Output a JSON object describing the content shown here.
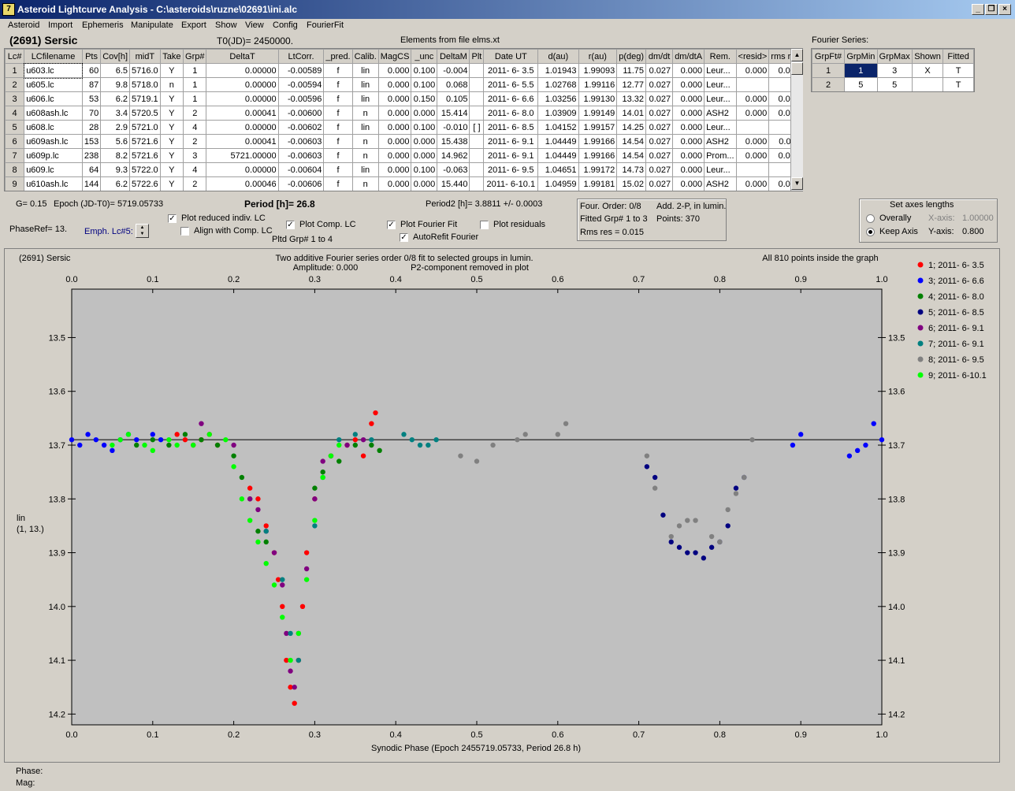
{
  "window": {
    "title": "Asteroid Lightcurve Analysis - C:\\asteroids\\ruzne\\02691\\ini.alc",
    "icon": "app-logo-icon"
  },
  "menu": [
    "Asteroid",
    "Import",
    "Ephemeris",
    "Manipulate",
    "Export",
    "Show",
    "View",
    "Config",
    "FourierFit"
  ],
  "header": {
    "asteroid": "(2691) Sersic",
    "t0": "T0(JD)= 2450000.",
    "elements": "Elements from file elms.xt",
    "fourier_title": "Fourier Series:"
  },
  "table": {
    "columns": [
      "Lc#",
      "LCfilename",
      "Pts",
      "Cov[h]",
      "midT",
      "Take",
      "Grp#",
      "DeltaT",
      "LtCorr.",
      "_pred.",
      "Calib.",
      "MagCS",
      "_unc",
      "DeltaM",
      "Plt",
      "Date UT",
      "d(au)",
      "r(au)",
      "p(deg)",
      "dm/dt",
      "dm/dtA",
      "Rem.",
      "<resid>",
      "rms res"
    ],
    "rows": [
      [
        "1",
        "u603.lc",
        "60",
        "6.5",
        "5716.0",
        "Y",
        "1",
        "0.00000",
        "-0.00589",
        "f",
        "lin",
        "0.000",
        "0.100",
        "-0.004",
        "",
        "2011- 6- 3.5",
        "1.01943",
        "1.99093",
        "11.75",
        "0.027",
        "0.000",
        "Leur...",
        "0.000",
        "0.017"
      ],
      [
        "2",
        "u605.lc",
        "87",
        "9.8",
        "5718.0",
        "n",
        "1",
        "0.00000",
        "-0.00594",
        "f",
        "lin",
        "0.000",
        "0.100",
        "0.068",
        "",
        "2011- 6- 5.5",
        "1.02768",
        "1.99116",
        "12.77",
        "0.027",
        "0.000",
        "Leur...",
        "",
        ""
      ],
      [
        "3",
        "u606.lc",
        "53",
        "6.2",
        "5719.1",
        "Y",
        "1",
        "0.00000",
        "-0.00596",
        "f",
        "lin",
        "0.000",
        "0.150",
        "0.105",
        "",
        "2011- 6- 6.6",
        "1.03256",
        "1.99130",
        "13.32",
        "0.027",
        "0.000",
        "Leur...",
        "0.000",
        "0.016"
      ],
      [
        "4",
        "u608ash.lc",
        "70",
        "3.4",
        "5720.5",
        "Y",
        "2",
        "0.00041",
        "-0.00600",
        "f",
        "n",
        "0.000",
        "0.000",
        "15.414",
        "",
        "2011- 6- 8.0",
        "1.03909",
        "1.99149",
        "14.01",
        "0.027",
        "0.000",
        "ASH2",
        "0.000",
        "0.018"
      ],
      [
        "5",
        "u608.lc",
        "28",
        "2.9",
        "5721.0",
        "Y",
        "4",
        "0.00000",
        "-0.00602",
        "f",
        "lin",
        "0.000",
        "0.100",
        "-0.010",
        "[ ]",
        "2011- 6- 8.5",
        "1.04152",
        "1.99157",
        "14.25",
        "0.027",
        "0.000",
        "Leur...",
        "",
        ""
      ],
      [
        "6",
        "u609ash.lc",
        "153",
        "5.6",
        "5721.6",
        "Y",
        "2",
        "0.00041",
        "-0.00603",
        "f",
        "n",
        "0.000",
        "0.000",
        "15.438",
        "",
        "2011- 6- 9.1",
        "1.04449",
        "1.99166",
        "14.54",
        "0.027",
        "0.000",
        "ASH2",
        "0.000",
        "0.011"
      ],
      [
        "7",
        "u609p.lc",
        "238",
        "8.2",
        "5721.6",
        "Y",
        "3",
        "5721.00000",
        "-0.00603",
        "f",
        "n",
        "0.000",
        "0.000",
        "14.962",
        "",
        "2011- 6- 9.1",
        "1.04449",
        "1.99166",
        "14.54",
        "0.027",
        "0.000",
        "Prom...",
        "0.000",
        "0.014"
      ],
      [
        "8",
        "u609.lc",
        "64",
        "9.3",
        "5722.0",
        "Y",
        "4",
        "0.00000",
        "-0.00604",
        "f",
        "lin",
        "0.000",
        "0.100",
        "-0.063",
        "",
        "2011- 6- 9.5",
        "1.04651",
        "1.99172",
        "14.73",
        "0.027",
        "0.000",
        "Leur...",
        "",
        ""
      ],
      [
        "9",
        "u610ash.lc",
        "144",
        "6.2",
        "5722.6",
        "Y",
        "2",
        "0.00046",
        "-0.00606",
        "f",
        "n",
        "0.000",
        "0.000",
        "15.440",
        "",
        "2011- 6-10.1",
        "1.04959",
        "1.99181",
        "15.02",
        "0.027",
        "0.000",
        "ASH2",
        "0.000",
        "0.015"
      ]
    ]
  },
  "fourier": {
    "columns": [
      "GrpFt#",
      "GrpMin",
      "GrpMax",
      "Shown",
      "Fitted"
    ],
    "rows": [
      [
        "1",
        "1",
        "3",
        "X",
        "T"
      ],
      [
        "2",
        "5",
        "5",
        "",
        "T"
      ]
    ]
  },
  "info": {
    "g": "G= 0.15",
    "epoch": "Epoch (JD-T0)= 5719.05733",
    "period": "Period [h]= 26.8",
    "period2": "Period2 [h]= 3.8811 +/- 0.0003",
    "phaseref": "PhaseRef= 13.",
    "emph": "Emph. Lc#5:",
    "pltd": "Pltd Grp#  1   to    4"
  },
  "checks": [
    {
      "label": "Plot reduced indiv. LC",
      "on": true
    },
    {
      "label": "Align with Comp. LC",
      "on": false
    },
    {
      "label": "Plot Comp. LC",
      "on": true
    },
    {
      "label": "Plot Fourier Fit",
      "on": true
    },
    {
      "label": "Plot residuals",
      "on": false
    },
    {
      "label": "AutoRefit Fourier",
      "on": true
    }
  ],
  "fitinfo": {
    "order": "Four. Order:  0/8",
    "add": "Add. 2-P, in lumin.",
    "fitted": "Fitted Grp# 1 to 3",
    "points": "Points: 370",
    "rms": "Rms res     = 0.015"
  },
  "axes_box": {
    "title": "Set axes lengths",
    "overally": "Overally",
    "keep": "Keep Axis",
    "xaxis": "X-axis:",
    "xval": "1.00000",
    "yaxis": "Y-axis:",
    "yval": "0.800",
    "selected": "Keep Axis"
  },
  "plot": {
    "name": "(2691) Sersic",
    "desc1": "Two additive Fourier series order 0/8 fit to selected groups in lumin.",
    "desc2": "Amplitude: 0.000",
    "desc3": "P2-component removed in plot",
    "inside": "All 810 points inside the graph",
    "ylabel1": "lin",
    "ylabel2": "(1, 13.)",
    "xlabel": "Synodic Phase (Epoch 2455719.05733, Period 26.8 h)"
  },
  "status": {
    "phase": "Phase:",
    "mag": "Mag:"
  },
  "chart_data": {
    "type": "scatter",
    "xlim": [
      0,
      1
    ],
    "ylim": [
      14.22,
      13.41
    ],
    "ylim_note": "inverted",
    "xticks": [
      "0.0",
      "0.1",
      "0.2",
      "0.3",
      "0.4",
      "0.5",
      "0.6",
      "0.7",
      "0.8",
      "0.9",
      "1.0"
    ],
    "yticks": [
      "13.5",
      "13.6",
      "13.7",
      "13.8",
      "13.9",
      "14.0",
      "14.1",
      "14.2"
    ],
    "fit_line": 13.69,
    "series": [
      {
        "name": "1; 2011- 6- 3.5",
        "color": "#ff0000",
        "points": [
          [
            0.13,
            13.68
          ],
          [
            0.14,
            13.69
          ],
          [
            0.15,
            13.7
          ],
          [
            0.16,
            13.69
          ],
          [
            0.17,
            13.68
          ],
          [
            0.18,
            13.7
          ],
          [
            0.22,
            13.78
          ],
          [
            0.23,
            13.8
          ],
          [
            0.24,
            13.85
          ],
          [
            0.25,
            13.9
          ],
          [
            0.255,
            13.95
          ],
          [
            0.26,
            14.0
          ],
          [
            0.265,
            14.1
          ],
          [
            0.27,
            14.15
          ],
          [
            0.275,
            14.18
          ],
          [
            0.28,
            14.1
          ],
          [
            0.285,
            14.0
          ],
          [
            0.29,
            13.9
          ],
          [
            0.3,
            13.8
          ],
          [
            0.32,
            13.72
          ],
          [
            0.34,
            13.7
          ],
          [
            0.35,
            13.69
          ],
          [
            0.36,
            13.72
          ],
          [
            0.37,
            13.66
          ],
          [
            0.375,
            13.64
          ]
        ]
      },
      {
        "name": "3; 2011- 6- 6.6",
        "color": "#0000ff",
        "points": [
          [
            0.0,
            13.69
          ],
          [
            0.01,
            13.7
          ],
          [
            0.02,
            13.68
          ],
          [
            0.03,
            13.69
          ],
          [
            0.04,
            13.7
          ],
          [
            0.05,
            13.71
          ],
          [
            0.06,
            13.69
          ],
          [
            0.07,
            13.68
          ],
          [
            0.08,
            13.69
          ],
          [
            0.1,
            13.68
          ],
          [
            0.11,
            13.69
          ],
          [
            0.9,
            13.68
          ],
          [
            0.89,
            13.7
          ],
          [
            0.96,
            13.72
          ],
          [
            0.97,
            13.71
          ],
          [
            0.98,
            13.7
          ],
          [
            0.99,
            13.66
          ],
          [
            1.0,
            13.69
          ]
        ]
      },
      {
        "name": "4; 2011- 6- 8.0",
        "color": "#008000",
        "points": [
          [
            0.08,
            13.7
          ],
          [
            0.1,
            13.69
          ],
          [
            0.12,
            13.7
          ],
          [
            0.14,
            13.68
          ],
          [
            0.16,
            13.69
          ],
          [
            0.18,
            13.7
          ],
          [
            0.2,
            13.72
          ],
          [
            0.21,
            13.76
          ],
          [
            0.22,
            13.8
          ],
          [
            0.23,
            13.86
          ],
          [
            0.24,
            13.88
          ],
          [
            0.3,
            13.78
          ],
          [
            0.31,
            13.75
          ],
          [
            0.32,
            13.72
          ],
          [
            0.33,
            13.73
          ],
          [
            0.35,
            13.7
          ],
          [
            0.37,
            13.7
          ],
          [
            0.38,
            13.71
          ]
        ]
      },
      {
        "name": "5; 2011- 6- 8.5",
        "color": "#000080",
        "points": [
          [
            0.71,
            13.74
          ],
          [
            0.72,
            13.76
          ],
          [
            0.73,
            13.83
          ],
          [
            0.74,
            13.88
          ],
          [
            0.75,
            13.89
          ],
          [
            0.76,
            13.9
          ],
          [
            0.77,
            13.9
          ],
          [
            0.78,
            13.91
          ],
          [
            0.79,
            13.89
          ],
          [
            0.8,
            13.88
          ],
          [
            0.81,
            13.85
          ],
          [
            0.82,
            13.78
          ],
          [
            0.83,
            13.76
          ]
        ]
      },
      {
        "name": "6; 2011- 6- 9.1",
        "color": "#800080",
        "points": [
          [
            0.16,
            13.66
          ],
          [
            0.2,
            13.7
          ],
          [
            0.22,
            13.8
          ],
          [
            0.23,
            13.82
          ],
          [
            0.24,
            13.86
          ],
          [
            0.25,
            13.9
          ],
          [
            0.26,
            13.96
          ],
          [
            0.265,
            14.05
          ],
          [
            0.27,
            14.12
          ],
          [
            0.275,
            14.15
          ],
          [
            0.28,
            14.05
          ],
          [
            0.29,
            13.93
          ],
          [
            0.3,
            13.8
          ],
          [
            0.31,
            13.73
          ],
          [
            0.34,
            13.7
          ],
          [
            0.36,
            13.69
          ]
        ]
      },
      {
        "name": "7; 2011- 6- 9.1",
        "color": "#008080",
        "points": [
          [
            0.24,
            13.86
          ],
          [
            0.26,
            13.95
          ],
          [
            0.27,
            14.05
          ],
          [
            0.28,
            14.1
          ],
          [
            0.3,
            13.85
          ],
          [
            0.31,
            13.76
          ],
          [
            0.33,
            13.69
          ],
          [
            0.35,
            13.68
          ],
          [
            0.37,
            13.69
          ],
          [
            0.41,
            13.68
          ],
          [
            0.42,
            13.69
          ],
          [
            0.43,
            13.7
          ],
          [
            0.44,
            13.7
          ],
          [
            0.45,
            13.69
          ]
        ]
      },
      {
        "name": "8; 2011- 6- 9.5",
        "color": "#808080",
        "points": [
          [
            0.48,
            13.72
          ],
          [
            0.5,
            13.73
          ],
          [
            0.52,
            13.7
          ],
          [
            0.55,
            13.69
          ],
          [
            0.56,
            13.68
          ],
          [
            0.6,
            13.68
          ],
          [
            0.61,
            13.66
          ],
          [
            0.71,
            13.72
          ],
          [
            0.72,
            13.78
          ],
          [
            0.74,
            13.87
          ],
          [
            0.75,
            13.85
          ],
          [
            0.76,
            13.84
          ],
          [
            0.77,
            13.84
          ],
          [
            0.79,
            13.87
          ],
          [
            0.8,
            13.88
          ],
          [
            0.81,
            13.82
          ],
          [
            0.82,
            13.79
          ],
          [
            0.83,
            13.76
          ],
          [
            0.84,
            13.69
          ]
        ]
      },
      {
        "name": "9; 2011- 6-10.1",
        "color": "#00ff00",
        "points": [
          [
            0.05,
            13.7
          ],
          [
            0.06,
            13.69
          ],
          [
            0.07,
            13.68
          ],
          [
            0.09,
            13.7
          ],
          [
            0.1,
            13.71
          ],
          [
            0.12,
            13.69
          ],
          [
            0.13,
            13.7
          ],
          [
            0.15,
            13.7
          ],
          [
            0.17,
            13.68
          ],
          [
            0.19,
            13.69
          ],
          [
            0.2,
            13.74
          ],
          [
            0.21,
            13.8
          ],
          [
            0.22,
            13.84
          ],
          [
            0.23,
            13.88
          ],
          [
            0.24,
            13.92
          ],
          [
            0.25,
            13.96
          ],
          [
            0.26,
            14.02
          ],
          [
            0.27,
            14.1
          ],
          [
            0.28,
            14.05
          ],
          [
            0.29,
            13.95
          ],
          [
            0.3,
            13.84
          ],
          [
            0.31,
            13.76
          ],
          [
            0.32,
            13.72
          ],
          [
            0.33,
            13.7
          ]
        ]
      }
    ]
  }
}
